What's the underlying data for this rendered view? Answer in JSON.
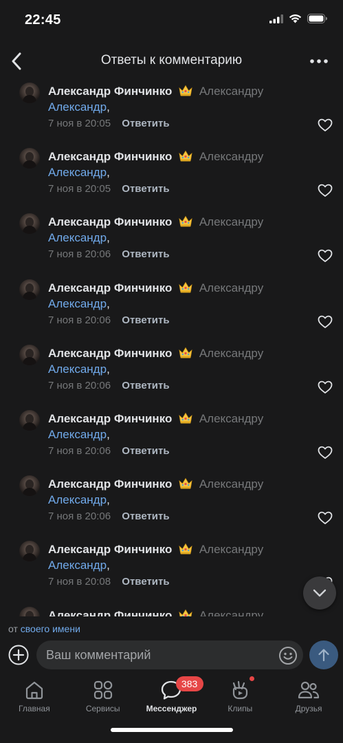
{
  "status_bar": {
    "time": "22:45"
  },
  "nav": {
    "title": "Ответы к комментарию"
  },
  "comments": [
    {
      "author": "Александр Финчинко",
      "reply_to": "Александру",
      "mention": "Александр",
      "suffix": ",",
      "date": "7 ноя в 20:05",
      "reply_label": "Ответить"
    },
    {
      "author": "Александр Финчинко",
      "reply_to": "Александру",
      "mention": "Александр",
      "suffix": ",",
      "date": "7 ноя в 20:05",
      "reply_label": "Ответить"
    },
    {
      "author": "Александр Финчинко",
      "reply_to": "Александру",
      "mention": "Александр",
      "suffix": ",",
      "date": "7 ноя в 20:06",
      "reply_label": "Ответить"
    },
    {
      "author": "Александр Финчинко",
      "reply_to": "Александру",
      "mention": "Александр",
      "suffix": ",",
      "date": "7 ноя в 20:06",
      "reply_label": "Ответить"
    },
    {
      "author": "Александр Финчинко",
      "reply_to": "Александру",
      "mention": "Александр",
      "suffix": ",",
      "date": "7 ноя в 20:06",
      "reply_label": "Ответить"
    },
    {
      "author": "Александр Финчинко",
      "reply_to": "Александру",
      "mention": "Александр",
      "suffix": ",",
      "date": "7 ноя в 20:06",
      "reply_label": "Ответить"
    },
    {
      "author": "Александр Финчинко",
      "reply_to": "Александру",
      "mention": "Александр",
      "suffix": ",",
      "date": "7 ноя в 20:06",
      "reply_label": "Ответить"
    },
    {
      "author": "Александр Финчинко",
      "reply_to": "Александру",
      "mention": "Александр",
      "suffix": ",",
      "date": "7 ноя в 20:08",
      "reply_label": "Ответить"
    },
    {
      "author": "Александр Финчинко",
      "reply_to": "Александру",
      "mention": "",
      "suffix": "",
      "date": "",
      "reply_label": ""
    }
  ],
  "composer": {
    "from_prefix": "от",
    "from_link": "своего имени",
    "placeholder": "Ваш комментарий",
    "value": ""
  },
  "tabbar": {
    "tabs": [
      {
        "label": "Главная",
        "icon": "home-icon"
      },
      {
        "label": "Сервисы",
        "icon": "services-icon"
      },
      {
        "label": "Мессенджер",
        "icon": "messenger-icon",
        "badge": "383",
        "active": true
      },
      {
        "label": "Клипы",
        "icon": "clips-icon",
        "dot": true
      },
      {
        "label": "Друзья",
        "icon": "friends-icon"
      }
    ]
  },
  "colors": {
    "background": "#19191a",
    "accent_link": "#71aaeb",
    "secondary_text": "#76787a",
    "badge": "#e64646",
    "send_button": "#3a5a7f"
  }
}
